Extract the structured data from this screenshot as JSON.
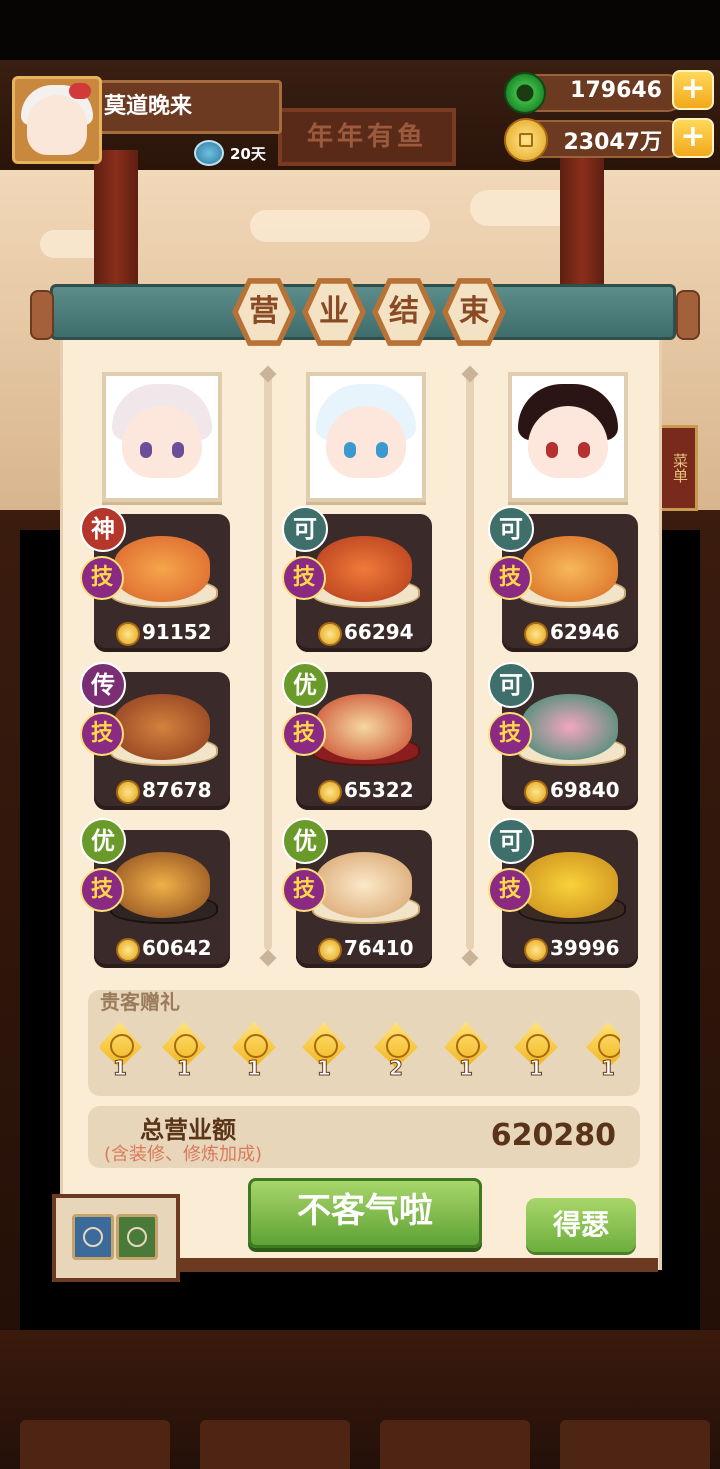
{
  "header": {
    "player_name": "莫道晚来",
    "days": "20天",
    "jade": "179646",
    "coins": "23047万",
    "plus_label": "+",
    "bg_sign": "年年有鱼",
    "side_sign": "菜单"
  },
  "banner": {
    "chars": [
      "营",
      "业",
      "结",
      "束"
    ]
  },
  "columns": [
    {
      "dishes": [
        {
          "grade": "神",
          "skill": "技",
          "value": "91152"
        },
        {
          "grade": "传",
          "skill": "技",
          "value": "87678"
        },
        {
          "grade": "优",
          "skill": "技",
          "value": "60642"
        }
      ]
    },
    {
      "dishes": [
        {
          "grade": "可",
          "skill": "技",
          "value": "66294"
        },
        {
          "grade": "优",
          "skill": "技",
          "value": "65322"
        },
        {
          "grade": "优",
          "skill": "技",
          "value": "76410"
        }
      ]
    },
    {
      "dishes": [
        {
          "grade": "可",
          "skill": "技",
          "value": "62946"
        },
        {
          "grade": "可",
          "skill": "技",
          "value": "69840"
        },
        {
          "grade": "可",
          "skill": "技",
          "value": "39996"
        }
      ]
    }
  ],
  "gifts": {
    "title": "贵客赠礼",
    "counts": [
      "1",
      "1",
      "1",
      "1",
      "2",
      "1",
      "1",
      "1"
    ]
  },
  "total": {
    "label": "总营业额",
    "sub": "(含装修、修炼加成)",
    "value": "620280"
  },
  "buttons": {
    "ok": "不客气啦",
    "share": "得瑟"
  },
  "colors": {
    "grade_shen": "#b5362b",
    "grade_chuan": "#7a2e74",
    "grade_you": "#6a9a2a",
    "grade_ke": "#3f6f6a",
    "skill_bg": "#8b2a82",
    "accent_green": "#5fa235"
  }
}
